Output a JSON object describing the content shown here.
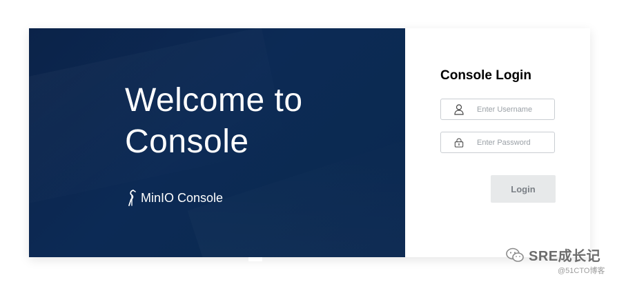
{
  "hero": {
    "welcome_line1": "Welcome to",
    "welcome_line2": "Console",
    "brand_text": "MinIO Console",
    "background_color": "#0b2349"
  },
  "login": {
    "title": "Console Login",
    "username_placeholder": "Enter Username",
    "password_placeholder": "Enter Password",
    "button_label": "Login",
    "username_icon": "user-icon",
    "password_icon": "lock-icon"
  },
  "watermark": {
    "title": "SRE成长记",
    "subtitle": "@51CTO博客",
    "icon": "wechat-icon"
  }
}
